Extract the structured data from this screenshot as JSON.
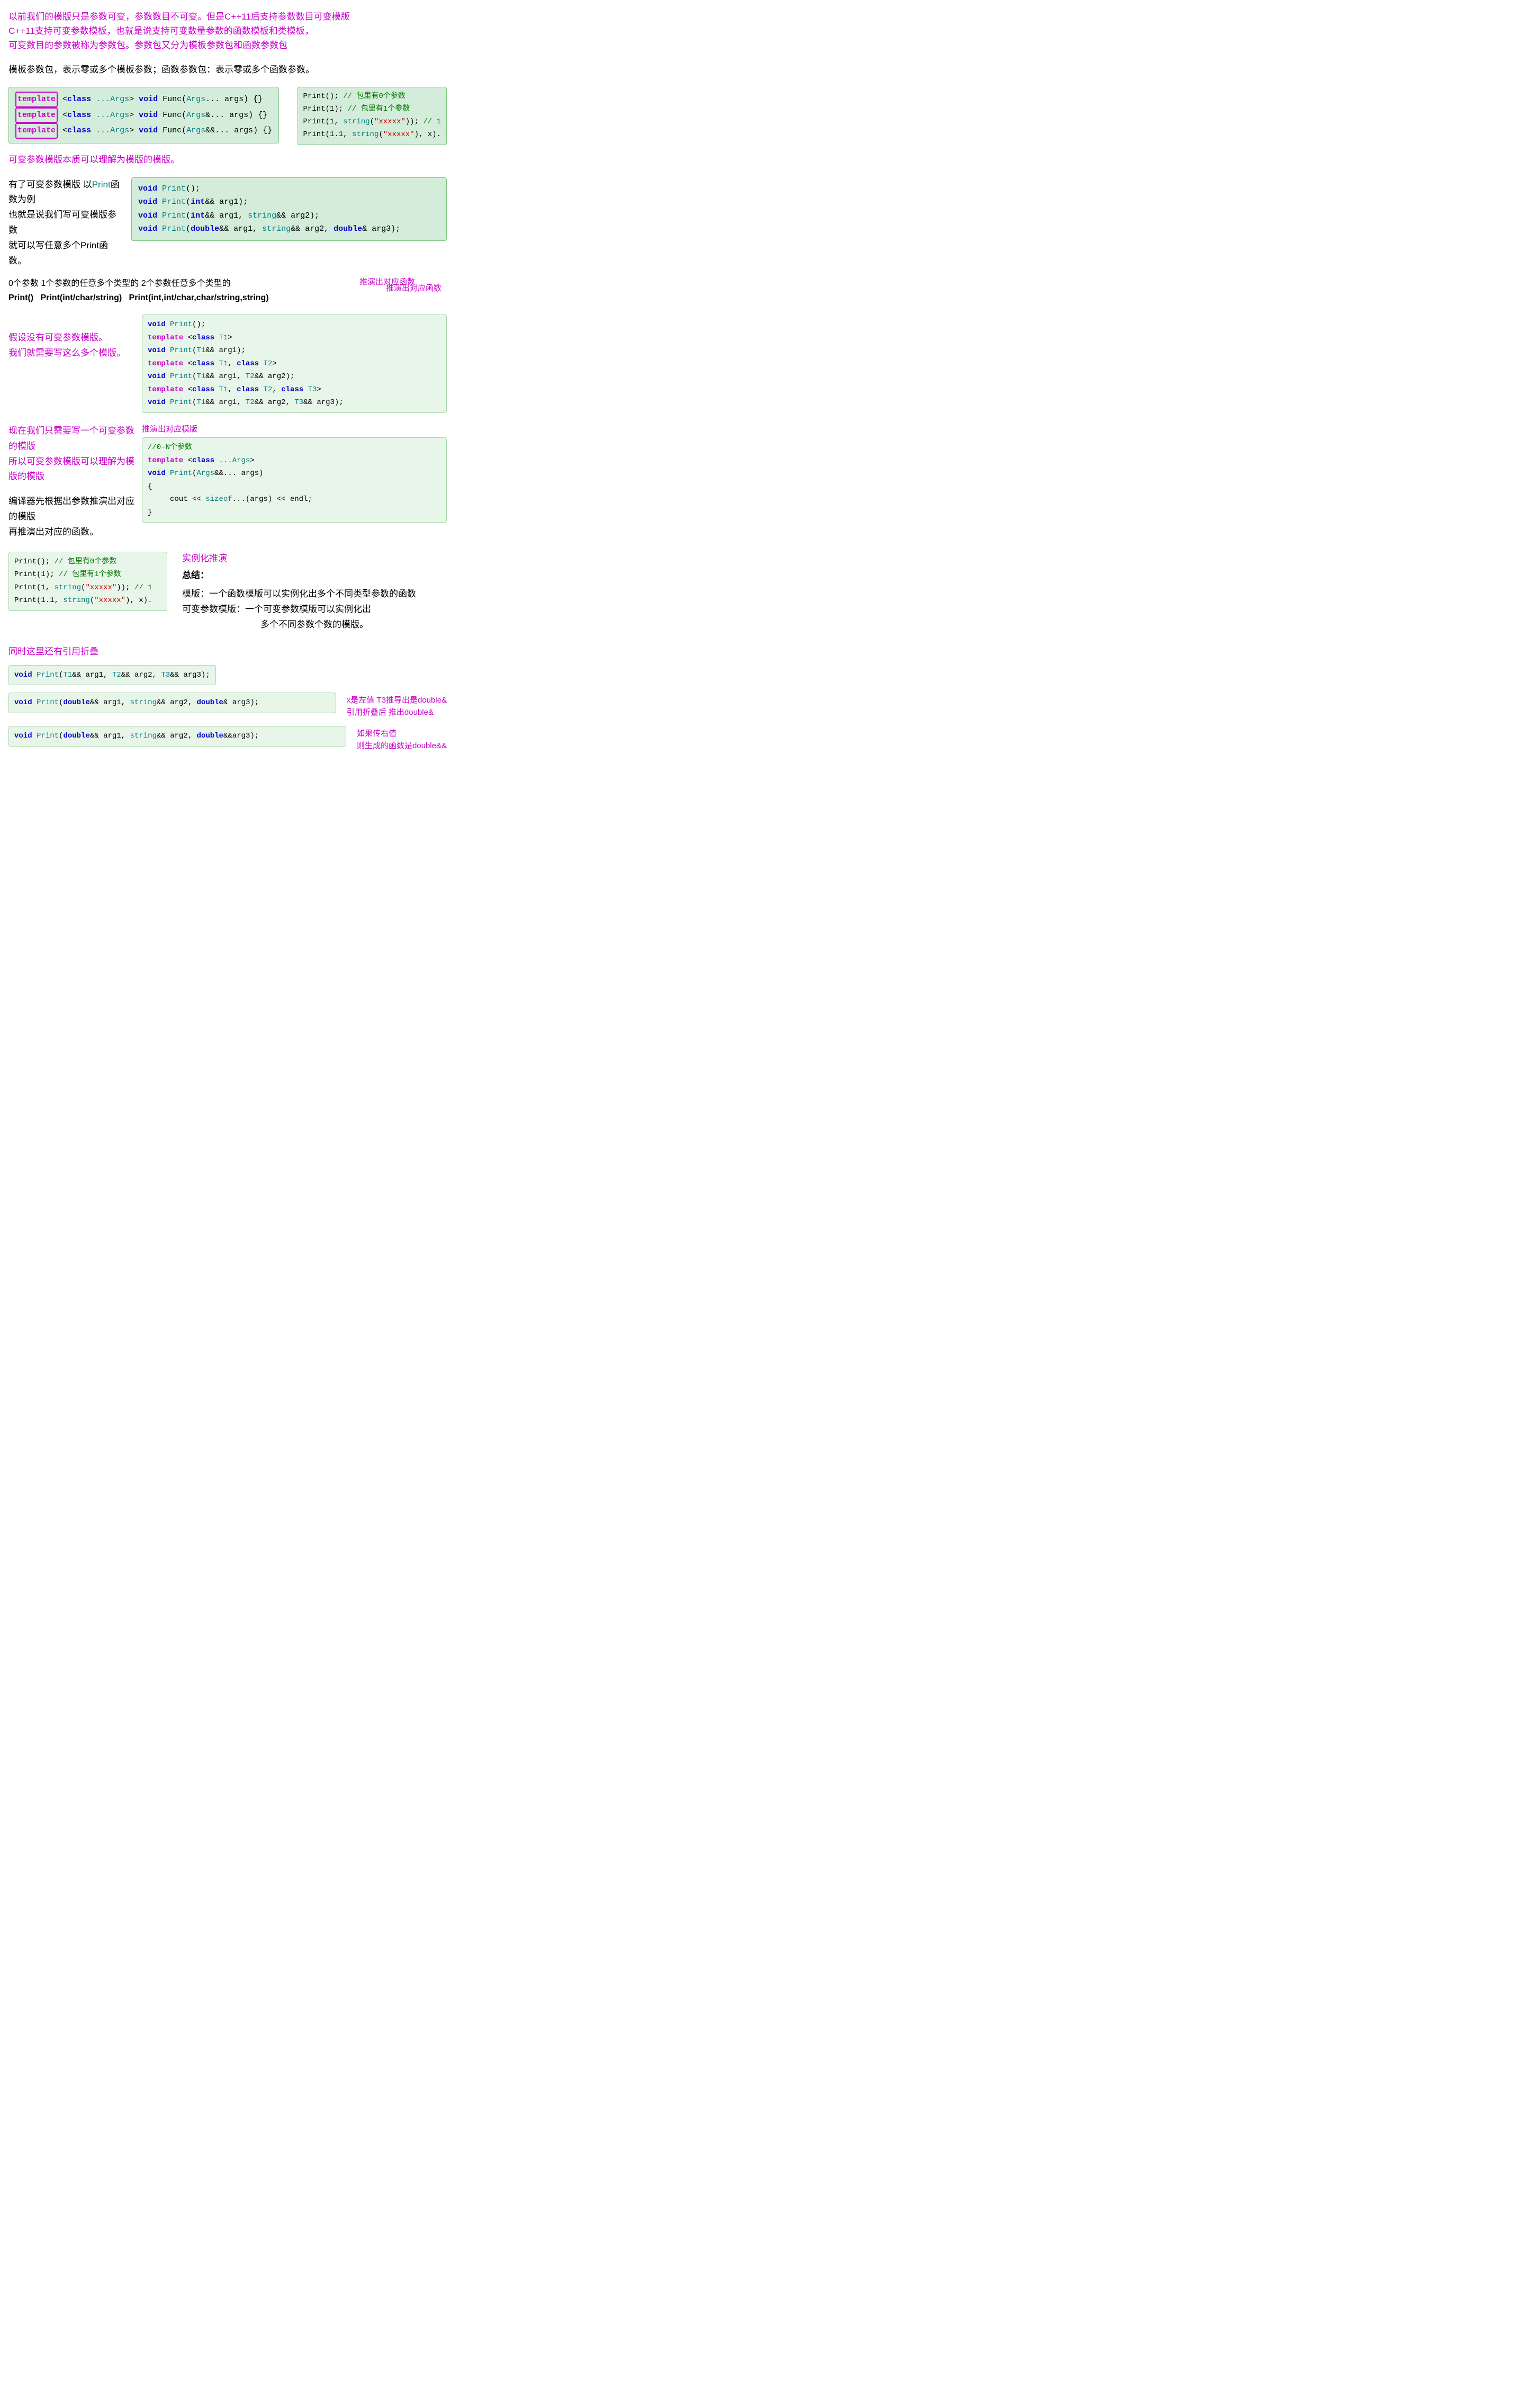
{
  "intro": {
    "line1": "以前我们的模版只是参数可变，参数数目不可变。但是C++11后支持参数数目可变模版",
    "line2": "C++11支持可变参数模板，也就是说支持可变数量参数的函数模板和类模板，",
    "line3": "可变数目的参数被称为参数包。参数包又分为模板参数包和函数参数包"
  },
  "desc1": "模板参数包，表示零或多个模板参数；函数参数包：表示零或多个函数参数。",
  "code_main": {
    "line1": "template <class ...Args> void Func(Args... args) {}",
    "line2": "template <class ...Args> void Func(Args&... args) {}",
    "line3": "template <class ...Args> void Func(Args&&... args) {}"
  },
  "side_calls": {
    "line1": "Print();  // 包里有0个参数",
    "line2": "Print(1); // 包里有1个参数",
    "line3": "Print(1, string(\"xxxxx\")); // 1",
    "line4": "Print(1.1, string(\"xxxxx\"), x)."
  },
  "purple_comment": "可变参数模版本质可以理解为模版的模版。",
  "example_intro": {
    "line1": "有了可变参数模版 以Print函数为例",
    "line2": "也就是说我们写可变模版参数",
    "line3": "就可以写任意多个Print函数。"
  },
  "print_signatures": {
    "line1": "void Print();",
    "line2": "void Print(int&& arg1);",
    "line3": "void Print(int&& arg1, string&& arg2);",
    "line4": "void Print(double&& arg1, string&& arg2, double& arg3);"
  },
  "zero_one_two": "0个参数  1个参数的任意多个类型的  2个参数任意多个类型的",
  "print_examples": "Print()    Print(int/char/string)    Print(int,int/char,char/string,string)",
  "deduced_func": "推演出对应函数",
  "no_variadic_comment": {
    "line1": "假设没有可变参数模版。",
    "line2": "我们就需要写这么多个模版。"
  },
  "template_list": {
    "line0": "void Print();",
    "line1": "template <class T1>",
    "line2": "void Print(T1&& arg1);",
    "line3": "template <class T1, class T2>",
    "line4": "void Print(T1&& arg1, T2&& arg2);",
    "line5": "template <class T1, class T2, class T3>",
    "line6": "void Print(T1&& arg1, T2&& arg2, T3&& arg3);"
  },
  "deduced_template": "推演出对应模版",
  "variadic_comment": {
    "line1": "现在我们只需要写一个可变参数的模版",
    "line2": "所以可变参数模版可以理解为模版的模版",
    "line3": "编译器先根据出参数推演出对应的模版",
    "line4": "再推演出对应的函数。"
  },
  "variadic_code": {
    "comment": "//0-N个参数",
    "line1": "template <class ...Args>",
    "line2": "void Print(Args&&... args)",
    "line3": "{",
    "line4": "    cout << sizeof...(args) << endl;",
    "line5": "}"
  },
  "calls_bottom": {
    "line1": "Print();  // 包里有0个参数",
    "line2": "Print(1); // 包里有1个参数",
    "line3": "Print(1, string(\"xxxxx\")); // 1",
    "line4": "Print(1.1, string(\"xxxxx\"), x)."
  },
  "instantiation_label": "实例化推演",
  "summary_title": "总结：",
  "summary_line1": "模版：一个函数模版可以实例化出多个不同类型参数的函数",
  "summary_line2": "可变参数模版：一个可变参数模版可以实例化出",
  "summary_line3": "多个不同参数个数的模版。",
  "ref_collapse_comment": "同时这里还有引用折叠",
  "code_ref1": "void Print(T1&& arg1, T2&& arg2, T3&& arg3);",
  "annotation_ref": {
    "line1": "x是左值 T3推导出是double&",
    "line2": "引用折叠后 推出double&"
  },
  "code_ref2": "void Print(double&& arg1, string&& arg2, double& arg3);",
  "code_ref3": "void Print(double&& arg1, string&& arg2, double&&arg3);",
  "annotation_rvalue": {
    "line1": "如果传右值",
    "line2": "则生成的函数是double&&"
  }
}
